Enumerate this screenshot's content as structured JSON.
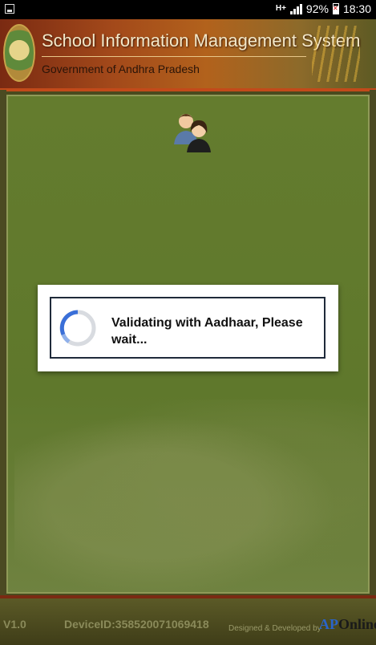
{
  "status_bar": {
    "network": "H+",
    "battery_percent": "92%",
    "time": "18:30"
  },
  "header": {
    "title": "School Information Management System",
    "subtitle": "Government of Andhra Pradesh"
  },
  "dialog": {
    "message": "Validating with Aadhaar, Please wait..."
  },
  "footer": {
    "version": "V1.0",
    "device_id": "DeviceID:358520071069418",
    "credit": "Designed & Developed  by",
    "logo_ap": "AP",
    "logo_online": "Online"
  },
  "colors": {
    "header_accent": "#c24a1a",
    "main_bg": "#647c2e",
    "spinner_blue": "#3a6fd8"
  },
  "icons": {
    "status_left": "gallery-icon",
    "main_center": "users-icon",
    "dialog": "loading-spinner-icon"
  }
}
